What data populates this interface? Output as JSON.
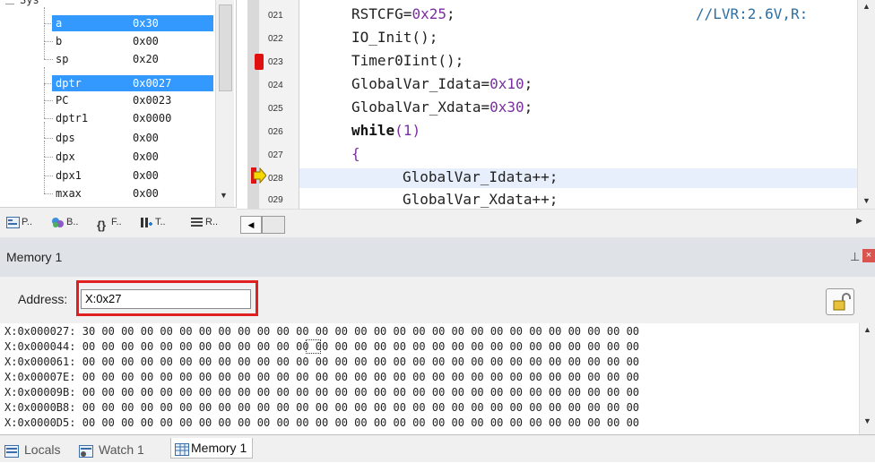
{
  "registers": [
    {
      "name": "a",
      "value": "0x30",
      "selected": true
    },
    {
      "name": "b",
      "value": "0x00",
      "selected": false
    },
    {
      "name": "sp",
      "value": "0x20",
      "selected": false
    },
    {
      "name": "dptr",
      "value": "0x0027",
      "selected": true
    },
    {
      "name": "PC",
      "value": "0x0023",
      "selected": false
    },
    {
      "name": "dptr1",
      "value": "0x0000",
      "selected": false
    },
    {
      "name": "dps",
      "value": "0x00",
      "selected": false
    },
    {
      "name": "dpx",
      "value": "0x00",
      "selected": false
    },
    {
      "name": "dpx1",
      "value": "0x00",
      "selected": false
    },
    {
      "name": "mxax",
      "value": "0x00",
      "selected": false
    }
  ],
  "panel_tabs": [
    {
      "label": "P..",
      "icon": "project-icon"
    },
    {
      "label": "B..",
      "icon": "books-icon"
    },
    {
      "label": "F..",
      "icon": "functions-icon"
    },
    {
      "label": "T..",
      "icon": "templates-icon"
    },
    {
      "label": "R..",
      "icon": "registers-icon"
    }
  ],
  "code": {
    "lines": [
      {
        "num": "021",
        "text": ""
      },
      {
        "num": "022",
        "text": "IO_Init();"
      },
      {
        "num": "023",
        "text": "Timer0Iint();"
      },
      {
        "num": "024",
        "text": ""
      },
      {
        "num": "025",
        "text": ""
      },
      {
        "num": "026",
        "text": ""
      },
      {
        "num": "027",
        "text": "{"
      },
      {
        "num": "028",
        "text": "GlobalVar_Idata++;"
      },
      {
        "num": "029",
        "text": "GlobalVar_Xdata++;"
      }
    ],
    "l21_a": "RSTCFG=",
    "l21_b": "0x25",
    "l21_c": ";",
    "l21_comment": "//LVR:2.6V,R:",
    "l24_a": "GlobalVar_Idata=",
    "l24_b": "0x10",
    "l24_c": ";",
    "l25_a": "GlobalVar_Xdata=",
    "l25_b": "0x30",
    "l25_c": ";",
    "l26_kw": "while",
    "l26_paren": "(1)",
    "breakpoint_line": "023",
    "current_line": "028"
  },
  "memory_window": {
    "title": "Memory 1",
    "address_label": "Address:",
    "address_value": "X:0x27",
    "rows": [
      {
        "addr": "X:0x000027:",
        "bytes": "30 00 00 00 00 00 00 00 00 00 00 00 00 00 00 00 00 00 00 00 00 00 00 00 00 00 00 00 00"
      },
      {
        "addr": "X:0x000044:",
        "bytes": "00 00 00 00 00 00 00 00 00 00 00 00 00 00 00 00 00 00 00 00 00 00 00 00 00 00 00 00 00"
      },
      {
        "addr": "X:0x000061:",
        "bytes": "00 00 00 00 00 00 00 00 00 00 00 00 00 00 00 00 00 00 00 00 00 00 00 00 00 00 00 00 00"
      },
      {
        "addr": "X:0x00007E:",
        "bytes": "00 00 00 00 00 00 00 00 00 00 00 00 00 00 00 00 00 00 00 00 00 00 00 00 00 00 00 00 00"
      },
      {
        "addr": "X:0x00009B:",
        "bytes": "00 00 00 00 00 00 00 00 00 00 00 00 00 00 00 00 00 00 00 00 00 00 00 00 00 00 00 00 00"
      },
      {
        "addr": "X:0x0000B8:",
        "bytes": "00 00 00 00 00 00 00 00 00 00 00 00 00 00 00 00 00 00 00 00 00 00 00 00 00 00 00 00 00"
      },
      {
        "addr": "X:0x0000D5:",
        "bytes": "00 00 00 00 00 00 00 00 00 00 00 00 00 00 00 00 00 00 00 00 00 00 00 00 00 00 00 00 00"
      }
    ]
  },
  "bottom_tabs": [
    {
      "label": "Locals",
      "active": false
    },
    {
      "label": "Watch 1",
      "active": false
    },
    {
      "label": "Memory 1",
      "active": true
    }
  ],
  "colors": {
    "selection": "#3399ff",
    "breakpoint": "#e01010",
    "highlight_box": "#e02020",
    "current_line": "#e8effc"
  }
}
